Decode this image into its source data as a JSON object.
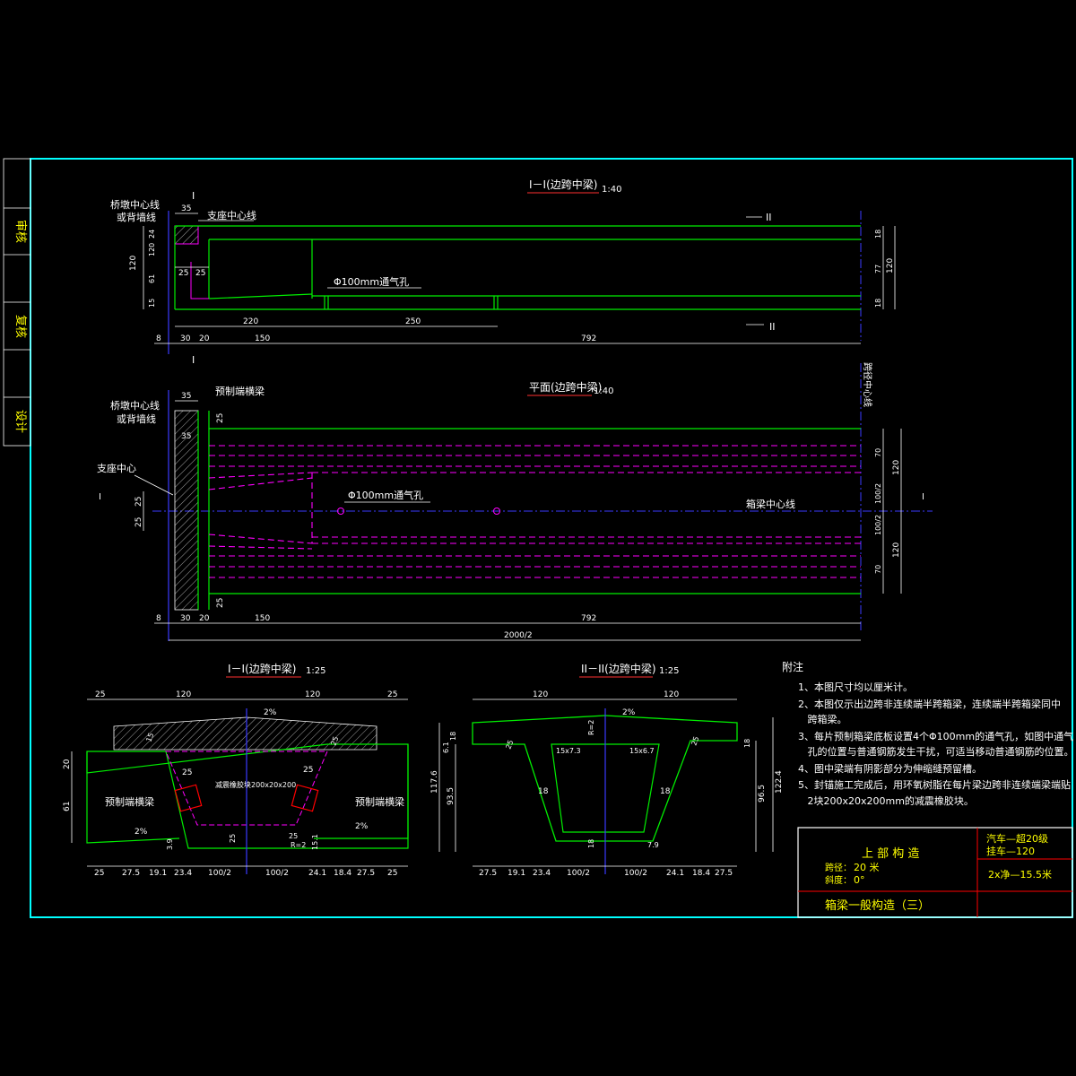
{
  "side_stamps": [
    "审核",
    "复核",
    "设计"
  ],
  "view1": {
    "title": "I－I(边跨中梁)",
    "scale": "1:40",
    "lbl_pier_line_a": "桥墩中心线",
    "lbl_pier_line_b": "或背墙线",
    "lbl_bearing": "支座中心线",
    "lbl_vent": "Φ100mm通气孔",
    "mark_I": "I",
    "mark_II": "II",
    "dims_top": [
      "35"
    ],
    "dims_left": [
      "120",
      "24",
      "120",
      "61",
      "15"
    ],
    "dims_inner": [
      "25",
      "25"
    ],
    "dims_right": [
      "18",
      "77",
      "18",
      "120"
    ],
    "dims_span": [
      "220",
      "250"
    ],
    "dims_bottom": [
      "8",
      "30",
      "20",
      "150",
      "792"
    ]
  },
  "view2": {
    "title": "平面(边跨中梁)",
    "scale": "1:40",
    "lbl_pier_line_a": "桥墩中心线",
    "lbl_pier_line_b": "或背墙线",
    "lbl_bearing": "支座中心",
    "lbl_crossbeam": "预制端横梁",
    "lbl_vent": "Φ100mm通气孔",
    "lbl_centerline": "箱梁中心线",
    "lbl_span_center": "跨径中心线",
    "mark_I": "I",
    "dims_top": [
      "35"
    ],
    "dims_inner": [
      "35",
      "25",
      "25"
    ],
    "dims_left": [
      "25",
      "25"
    ],
    "dims_right": [
      "70",
      "120",
      "100/2",
      "100/2",
      "120",
      "70"
    ],
    "dims_bottom": [
      "8",
      "30",
      "20",
      "150",
      "792"
    ],
    "dims_total": "2000/2"
  },
  "section1": {
    "title": "I－I(边跨中梁)",
    "scale": "1:25",
    "dims_top": [
      "25",
      "120",
      "120",
      "25"
    ],
    "slope_top": "2%",
    "slope_left": "2%",
    "slope_right": "2%",
    "lbl_left": "预制端横梁",
    "lbl_right": "预制端横梁",
    "lbl_bearing_block": "减震橡胶块200x20x200",
    "dims_misc": [
      "15",
      "25",
      "25",
      "25",
      "25",
      "20",
      "61",
      "3.9",
      "25",
      "15.1",
      "R=2"
    ],
    "dims_bottom": [
      "25",
      "27.5",
      "19.1",
      "23.4",
      "100/2",
      "100/2",
      "24.1",
      "18.4",
      "27.5",
      "25"
    ]
  },
  "section2": {
    "title": "II－II(边跨中梁)",
    "scale": "1:25",
    "dims_top": [
      "120",
      "120"
    ],
    "slope_top": "2%",
    "fillet_left": "15x7.3",
    "fillet_right": "15x6.7",
    "dims_misc": [
      "18",
      "6.1",
      "25",
      "25",
      "18",
      "18",
      "18",
      "R=2",
      "7.9",
      "18"
    ],
    "dims_left": [
      "117.6",
      "93.5"
    ],
    "dims_right": [
      "96.5",
      "122.4"
    ],
    "dims_bottom": [
      "27.5",
      "19.1",
      "23.4",
      "100/2",
      "100/2",
      "24.1",
      "18.4",
      "27.5"
    ]
  },
  "notes": {
    "title": "附注",
    "items": [
      "1、本图尺寸均以厘米计。",
      "2、本图仅示出边跨非连续端半跨箱梁，连续端半跨箱梁同中",
      "   跨箱梁。",
      "3、每片预制箱梁底板设置4个Φ100mm的通气孔，如图中通气",
      "   孔的位置与普通钢筋发生干扰，可适当移动普通钢筋的位置。",
      "4、图中梁端有阴影部分为伸缩缝预留槽。",
      "5、封锚施工完成后，用环氧树脂在每片梁边跨非连续端梁端贴",
      "   2块200x20x200mm的减震橡胶块。"
    ]
  },
  "title_block": {
    "project": "上 部 构 造",
    "span_label": "跨径：",
    "span_value": "20 米",
    "skew_label": "斜度：",
    "skew_value": "0°",
    "load1": "汽车—超20级",
    "load2": "挂车—120",
    "width": "2x净—15.5米",
    "drawing_title": "箱梁一般构造（三）"
  }
}
